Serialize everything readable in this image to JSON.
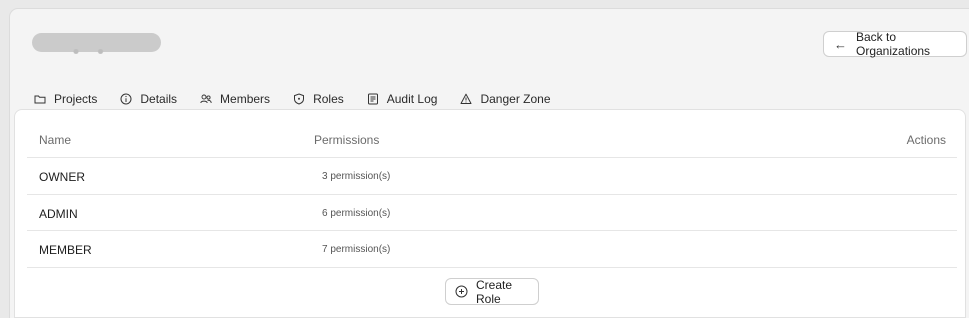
{
  "header": {
    "back_button_label": "Back to Organizations"
  },
  "tabs": [
    {
      "label": "Projects",
      "icon": "folder-icon"
    },
    {
      "label": "Details",
      "icon": "info-icon"
    },
    {
      "label": "Members",
      "icon": "users-icon"
    },
    {
      "label": "Roles",
      "icon": "shield-icon",
      "active": true
    },
    {
      "label": "Audit Log",
      "icon": "log-icon"
    },
    {
      "label": "Danger Zone",
      "icon": "warning-icon"
    }
  ],
  "roles_table": {
    "columns": [
      "Name",
      "Permissions",
      "Actions"
    ],
    "rows": [
      {
        "name": "OWNER",
        "permissions": "3 permission(s)"
      },
      {
        "name": "ADMIN",
        "permissions": "6 permission(s)"
      },
      {
        "name": "MEMBER",
        "permissions": "7 permission(s)"
      }
    ]
  },
  "create_role_label": "Create Role",
  "colors": {
    "active_tab_underline": "#3b5f8f",
    "background": "#f4f4f4",
    "card": "#ffffff"
  }
}
